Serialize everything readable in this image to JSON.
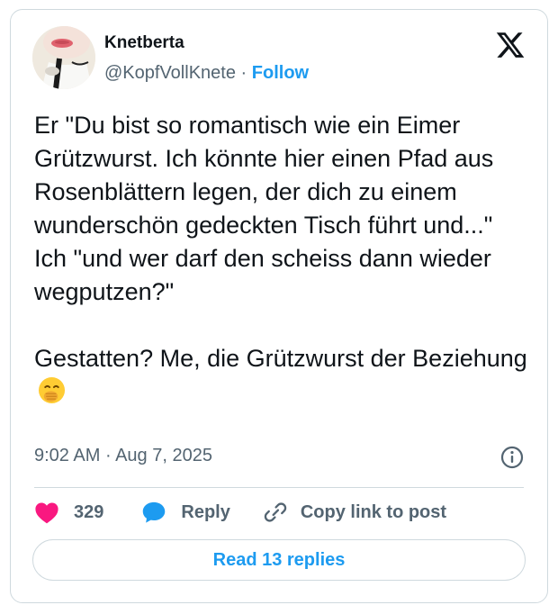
{
  "author": {
    "display_name": "Knetberta",
    "handle": "@KopfVollKnete",
    "separator": "·",
    "follow_label": "Follow"
  },
  "tweet": {
    "text": "Er \"Du bist so romantisch wie ein Eimer Grützwurst. Ich könnte hier einen Pfad aus Rosenblättern legen, der dich zu einem wunderschön gedeckten Tisch führt und...\"\nIch \"und wer darf den scheiss dann wieder wegputzen?\"\n\nGestatten? Me, die Grützwurst der Beziehung",
    "emoji": "🤭",
    "emoji_name": "face-with-hand-over-mouth",
    "time": "9:02 AM",
    "date_separator": "·",
    "date": "Aug 7, 2025"
  },
  "actions": {
    "like_count": "329",
    "reply_label": "Reply",
    "copy_link_label": "Copy link to post"
  },
  "read_replies_label": "Read 13 replies",
  "icons": {
    "logo": "x-logo-icon",
    "info": "info-icon",
    "like": "heart-icon",
    "reply": "speech-bubble-icon",
    "copy": "link-icon"
  },
  "colors": {
    "accent": "#1d9bf0",
    "like": "#f91880",
    "secondary_text": "#536471",
    "border": "#cfd9de"
  }
}
